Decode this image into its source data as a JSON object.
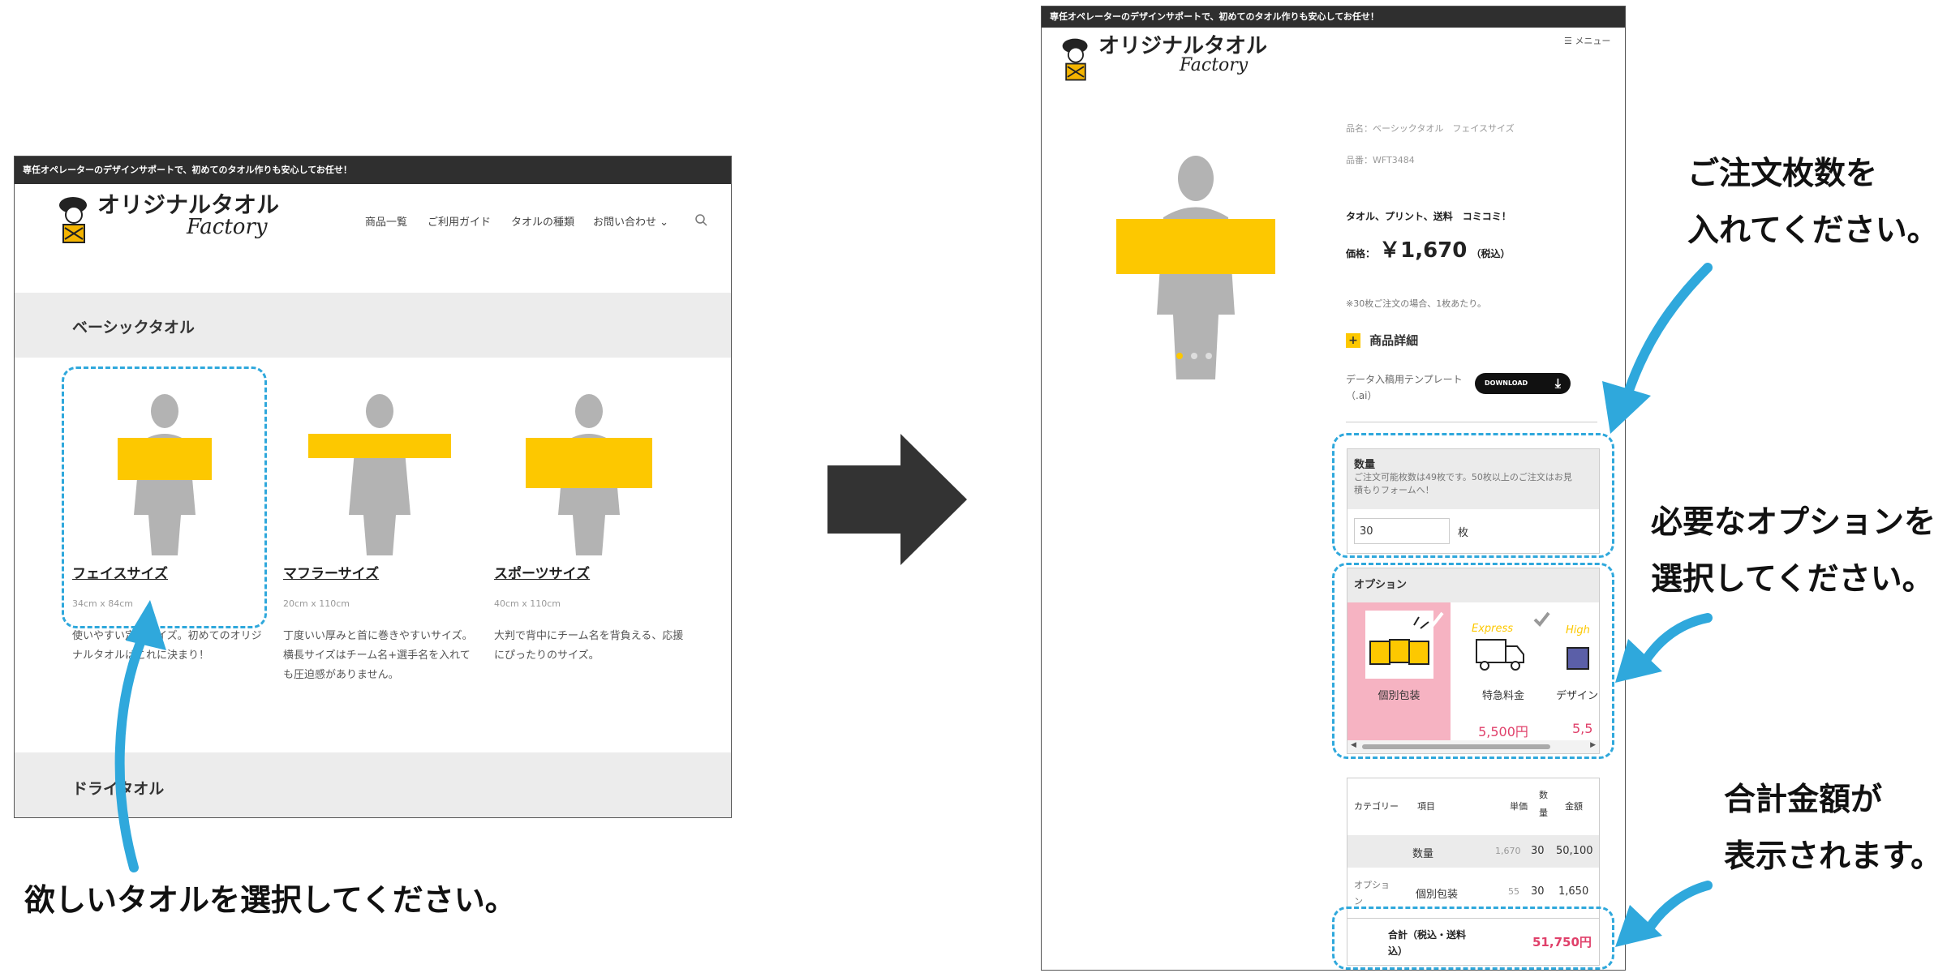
{
  "left": {
    "topbar": "専任オペレーターのデザインサポートで、初めてのタオル作りも安心してお任せ！",
    "logo": {
      "main": "オリジナルタオル",
      "sub": "Factory"
    },
    "nav": [
      "商品一覧",
      "ご利用ガイド",
      "タオルの種類",
      "お問い合わせ"
    ],
    "section1": "ベーシックタオル",
    "section2": "ドライタオル",
    "products": [
      {
        "name": "フェイスサイズ",
        "size": "34cm x 84cm",
        "desc": [
          "使いやすい定番サイズ。初めてのオリジ",
          "ナルタオルはこれに決まり！"
        ]
      },
      {
        "name": "マフラーサイズ",
        "size": "20cm x 110cm",
        "desc": [
          "丁度いい厚みと首に巻きやすいサイズ。",
          "横長サイズはチーム名+選手名を入れて",
          "も圧迫感がありません。"
        ]
      },
      {
        "name": "スポーツサイズ",
        "size": "40cm x 110cm",
        "desc": [
          "大判で背中にチーム名を背負える、応援",
          "にぴったりのサイズ。"
        ]
      }
    ]
  },
  "right": {
    "topbar": "専任オペレーターのデザインサポートで、初めてのタオル作りも安心してお任せ！",
    "logo": {
      "main": "オリジナルタオル",
      "sub": "Factory"
    },
    "menu": "メニュー",
    "product_name": "品名：ベーシックタオル　フェイスサイズ",
    "product_code": "品番：WFT3484",
    "tagline": "タオル、プリント、送料　コミコミ！",
    "price_label": "価格：",
    "price": "￥1,670",
    "price_tax": "（税込）",
    "note": "※30枚ご注文の場合、1枚あたり。",
    "details": "商品詳細",
    "template_label": [
      "データ入稿用テンプレート",
      "（.ai）"
    ],
    "download": "DOWNLOAD",
    "qty_title": "数量",
    "qty_note": [
      "ご注文可能枚数は49枚です。50枚以上のご注文はお見",
      "積もりフォームへ！"
    ],
    "qty_value": "30",
    "qty_unit": "枚",
    "options_title": "オプション",
    "options": [
      {
        "label": "個別包装",
        "price": ""
      },
      {
        "label": "特急料金",
        "price": "5,500円"
      },
      {
        "label": "デザイン",
        "price": "5,5"
      }
    ],
    "table": {
      "headers": [
        "カテゴリー",
        "項目",
        "単価",
        "数量",
        "金額"
      ],
      "rows": [
        {
          "category": "",
          "item": "数量",
          "unit": "1,670",
          "qty": "30",
          "amount": "50,100"
        },
        {
          "category": "オプション",
          "item": "個別包装",
          "unit": "55",
          "qty": "30",
          "amount": "1,650"
        }
      ],
      "total_label": [
        "合計（税込・送料",
        "込）"
      ],
      "total": "51,750円"
    }
  },
  "callouts": {
    "select_towel": "欲しいタオルを選択してください。",
    "quantity": [
      "ご注文枚数を",
      "入れてください。"
    ],
    "options": [
      "必要なオプションを",
      "選択してください。"
    ],
    "total": [
      "合計金額が",
      "表示されます。"
    ]
  },
  "colors": {
    "accent": "#2fa8dc",
    "towel": "#fdc800",
    "price": "#e0406a",
    "option_selected": "#f6b3c2",
    "topbar": "#2f2f2f"
  }
}
